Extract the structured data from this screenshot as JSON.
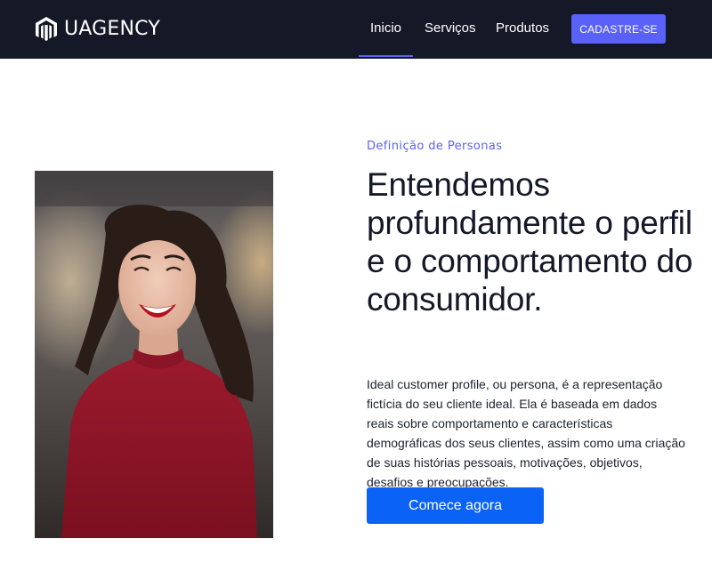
{
  "brand": {
    "name": "UAGENCY",
    "logo_icon": "magento-m-icon"
  },
  "nav": {
    "links": [
      {
        "label": "Inicio",
        "active": true
      },
      {
        "label": "Serviços",
        "active": false
      },
      {
        "label": "Produtos",
        "active": false
      }
    ],
    "cta_label": "CADASTRE-SE"
  },
  "hero": {
    "eyebrow": "Definição de Personas",
    "headline": "Entendemos profundamente o perfil e o comportamento do consumidor.",
    "body": "Ideal customer profile, ou persona, é a representação fictícia do seu cliente ideal. Ela é baseada em dados reais sobre comportamento e características demográficas dos seus clientes, assim como uma criação de suas histórias pessoais, motivações, objetivos, desafios e preocupações.",
    "cta_label": "Comece agora"
  },
  "colors": {
    "navbar_bg": "#141827",
    "accent": "#5961f9",
    "primary_button": "#0b63f6",
    "eyebrow": "#5a62f2"
  }
}
